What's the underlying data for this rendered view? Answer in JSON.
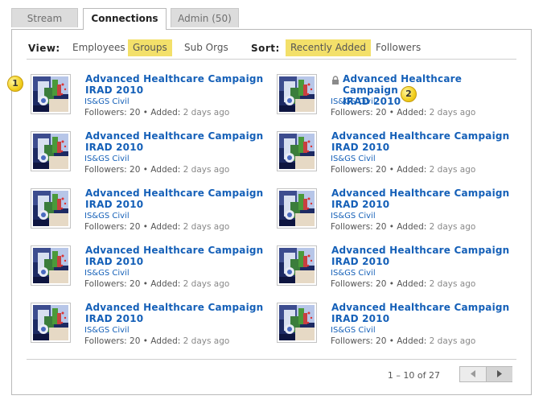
{
  "tabs": [
    {
      "label": "Stream",
      "active": false
    },
    {
      "label": "Connections",
      "active": true
    },
    {
      "label": "Admin (50)",
      "active": false
    }
  ],
  "filters": {
    "view_label": "View:",
    "view_options": [
      "Employees",
      "Groups",
      "Sub Orgs"
    ],
    "view_selected": "Groups",
    "sort_label": "Sort:",
    "sort_options": [
      "Recently Added",
      "Followers"
    ],
    "sort_selected": "Recently Added"
  },
  "groups": [
    {
      "title_line1": "Advanced Healthcare Campaign",
      "title_line2": "IRAD 2010",
      "org": "IS&GS Civil",
      "followers": "Followers: 20",
      "added": "Added:",
      "added_when": "2 days ago",
      "locked": false
    },
    {
      "title_line1": "Advanced Healthcare Campaign",
      "title_line2": "IRAD 2010",
      "org": "IS&GS Civil",
      "followers": "Followers: 20",
      "added": "Added:",
      "added_when": "2 days ago",
      "locked": true
    },
    {
      "title_line1": "Advanced Healthcare Campaign",
      "title_line2": "IRAD 2010",
      "org": "IS&GS Civil",
      "followers": "Followers: 20",
      "added": "Added:",
      "added_when": "2 days ago",
      "locked": false
    },
    {
      "title_line1": "Advanced Healthcare Campaign",
      "title_line2": "IRAD 2010",
      "org": "IS&GS Civil",
      "followers": "Followers: 20",
      "added": "Added:",
      "added_when": "2 days ago",
      "locked": false
    },
    {
      "title_line1": "Advanced Healthcare Campaign",
      "title_line2": "IRAD 2010",
      "org": "IS&GS Civil",
      "followers": "Followers: 20",
      "added": "Added:",
      "added_when": "2 days ago",
      "locked": false
    },
    {
      "title_line1": "Advanced Healthcare Campaign",
      "title_line2": "IRAD 2010",
      "org": "IS&GS Civil",
      "followers": "Followers: 20",
      "added": "Added:",
      "added_when": "2 days ago",
      "locked": false
    },
    {
      "title_line1": "Advanced Healthcare Campaign",
      "title_line2": "IRAD 2010",
      "org": "IS&GS Civil",
      "followers": "Followers: 20",
      "added": "Added:",
      "added_when": "2 days ago",
      "locked": false
    },
    {
      "title_line1": "Advanced Healthcare Campaign",
      "title_line2": "IRAD 2010",
      "org": "IS&GS Civil",
      "followers": "Followers: 20",
      "added": "Added:",
      "added_when": "2 days ago",
      "locked": false
    },
    {
      "title_line1": "Advanced Healthcare Campaign",
      "title_line2": "IRAD 2010",
      "org": "IS&GS Civil",
      "followers": "Followers: 20",
      "added": "Added:",
      "added_when": "2 days ago",
      "locked": false
    },
    {
      "title_line1": "Advanced Healthcare Campaign",
      "title_line2": "IRAD 2010",
      "org": "IS&GS Civil",
      "followers": "Followers: 20",
      "added": "Added:",
      "added_when": "2 days ago",
      "locked": false
    }
  ],
  "callouts": [
    "1",
    "2"
  ],
  "pagination": {
    "range_text": "1 – 10 of 27",
    "prev_icon": "left-arrow-icon",
    "next_icon": "right-arrow-icon"
  },
  "colors": {
    "link": "#1560b8",
    "highlight": "#f3e06a",
    "callout": "#f2cf1e"
  }
}
